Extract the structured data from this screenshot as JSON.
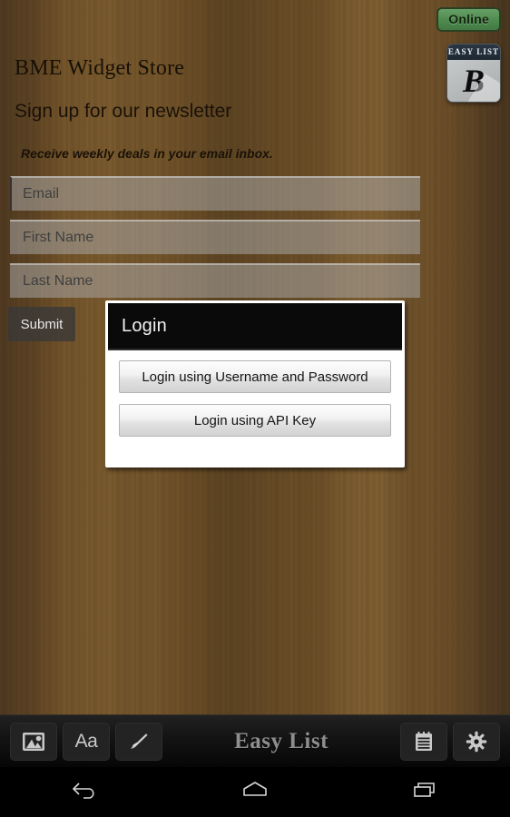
{
  "status": {
    "connection_label": "Online",
    "connection_color": "#4e8a4e"
  },
  "logo": {
    "band_text": "EASY LIST",
    "glyph": "B"
  },
  "page": {
    "store_title": "BME Widget Store",
    "newsletter_heading": "Sign up for our newsletter",
    "newsletter_subtext": "Receive weekly deals in your email inbox."
  },
  "form": {
    "fields": [
      {
        "name": "email",
        "value": "",
        "placeholder": "Email"
      },
      {
        "name": "first_name",
        "value": "",
        "placeholder": "First Name"
      },
      {
        "name": "last_name",
        "value": "",
        "placeholder": "Last Name"
      }
    ],
    "submit_label": "Submit"
  },
  "dialog": {
    "title": "Login",
    "buttons": [
      {
        "label": "Login using Username and Password"
      },
      {
        "label": "Login using API Key"
      }
    ]
  },
  "toolbar": {
    "brand": "Easy List",
    "left_buttons": [
      {
        "icon": "image-icon",
        "label": ""
      },
      {
        "icon": "font-icon",
        "label": "Aa"
      },
      {
        "icon": "brush-icon",
        "label": ""
      }
    ],
    "right_buttons": [
      {
        "icon": "notepad-icon",
        "label": ""
      },
      {
        "icon": "gear-icon",
        "label": ""
      }
    ]
  },
  "android_nav": {
    "buttons": [
      {
        "icon": "back-icon"
      },
      {
        "icon": "home-icon"
      },
      {
        "icon": "recents-icon"
      }
    ]
  }
}
